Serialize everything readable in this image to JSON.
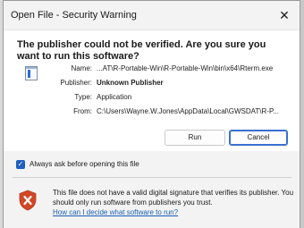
{
  "window": {
    "title": "Open File - Security Warning",
    "close_symbol": "✕"
  },
  "headline": "The publisher could not be verified.  Are you sure you want to run this software?",
  "details": {
    "icon": "application-icon",
    "name_label": "Name:",
    "name_value": "...AT\\R-Portable-Win\\R-Portable-Win\\bin\\x64\\Rterm.exe",
    "publisher_label": "Publisher:",
    "publisher_value": "Unknown Publisher",
    "type_label": "Type:",
    "type_value": "Application",
    "from_label": "From:",
    "from_value": "C:\\Users\\Wayne.W.Jones\\AppData\\Local\\GWSDAT\\R-P..."
  },
  "buttons": {
    "run": "Run",
    "cancel": "Cancel"
  },
  "checkbox": {
    "label": "Always ask before opening this file",
    "checked": true,
    "check_symbol": "✓"
  },
  "warning": {
    "icon": "shield-warning-icon",
    "text": "This file does not have a valid digital signature that verifies its publisher.  You should only run software from publishers you trust.",
    "link": "How can I decide what software to run?"
  },
  "colors": {
    "accent": "#1f5fbf",
    "link": "#1a5fb4",
    "shield": "#d24726"
  }
}
